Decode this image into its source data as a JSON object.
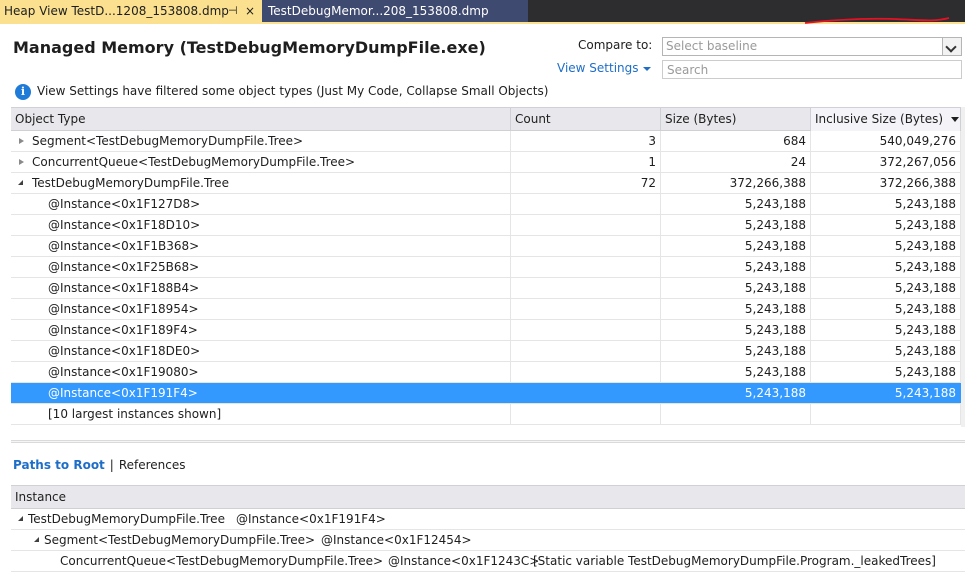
{
  "tabs": {
    "active": "Heap View TestD...1208_153808.dmp",
    "active_pin": "⊣",
    "active_close": "×",
    "inactive": "TestDebugMemor...208_153808.dmp"
  },
  "header": {
    "title": "Managed Memory (TestDebugMemoryDumpFile.exe)",
    "compare_label": "Compare to:",
    "baseline_placeholder": "Select baseline",
    "view_settings": "View Settings",
    "search_placeholder": "Search"
  },
  "info": {
    "icon": "i",
    "text": "View Settings have filtered some object types (Just My Code, Collapse Small Objects)"
  },
  "grid": {
    "columns": [
      "Object Type",
      "Count",
      "Size (Bytes)",
      "Inclusive Size (Bytes)"
    ],
    "sorted_column": "Inclusive Size (Bytes)",
    "rows": [
      {
        "name": "Segment<TestDebugMemoryDumpFile.Tree>",
        "count": "3",
        "size": "684",
        "inclusive": "540,049,276",
        "level": 0,
        "expander": "collapsed",
        "selected": false
      },
      {
        "name": "ConcurrentQueue<TestDebugMemoryDumpFile.Tree>",
        "count": "1",
        "size": "24",
        "inclusive": "372,267,056",
        "level": 0,
        "expander": "collapsed",
        "selected": false
      },
      {
        "name": "TestDebugMemoryDumpFile.Tree",
        "count": "72",
        "size": "372,266,388",
        "inclusive": "372,266,388",
        "level": 0,
        "expander": "expanded",
        "selected": false
      },
      {
        "name": "@Instance<0x1F127D8>",
        "count": "",
        "size": "5,243,188",
        "inclusive": "5,243,188",
        "level": 1,
        "expander": "none",
        "selected": false
      },
      {
        "name": "@Instance<0x1F18D10>",
        "count": "",
        "size": "5,243,188",
        "inclusive": "5,243,188",
        "level": 1,
        "expander": "none",
        "selected": false
      },
      {
        "name": "@Instance<0x1F1B368>",
        "count": "",
        "size": "5,243,188",
        "inclusive": "5,243,188",
        "level": 1,
        "expander": "none",
        "selected": false
      },
      {
        "name": "@Instance<0x1F25B68>",
        "count": "",
        "size": "5,243,188",
        "inclusive": "5,243,188",
        "level": 1,
        "expander": "none",
        "selected": false
      },
      {
        "name": "@Instance<0x1F188B4>",
        "count": "",
        "size": "5,243,188",
        "inclusive": "5,243,188",
        "level": 1,
        "expander": "none",
        "selected": false
      },
      {
        "name": "@Instance<0x1F18954>",
        "count": "",
        "size": "5,243,188",
        "inclusive": "5,243,188",
        "level": 1,
        "expander": "none",
        "selected": false
      },
      {
        "name": "@Instance<0x1F189F4>",
        "count": "",
        "size": "5,243,188",
        "inclusive": "5,243,188",
        "level": 1,
        "expander": "none",
        "selected": false
      },
      {
        "name": "@Instance<0x1F18DE0>",
        "count": "",
        "size": "5,243,188",
        "inclusive": "5,243,188",
        "level": 1,
        "expander": "none",
        "selected": false
      },
      {
        "name": "@Instance<0x1F19080>",
        "count": "",
        "size": "5,243,188",
        "inclusive": "5,243,188",
        "level": 1,
        "expander": "none",
        "selected": false
      },
      {
        "name": "@Instance<0x1F191F4>",
        "count": "",
        "size": "5,243,188",
        "inclusive": "5,243,188",
        "level": 1,
        "expander": "none",
        "selected": true
      },
      {
        "name": "[10 largest instances shown]",
        "count": "",
        "size": "",
        "inclusive": "",
        "level": 1,
        "expander": "none",
        "selected": false
      }
    ]
  },
  "lower": {
    "tab_paths": "Paths to Root",
    "separator": "|",
    "tab_references": "References",
    "column": "Instance",
    "paths": [
      {
        "type": "TestDebugMemoryDumpFile.Tree",
        "instance": "@Instance<0x1F191F4>",
        "extra": "",
        "level": 0,
        "expander": "expanded"
      },
      {
        "type": "Segment<TestDebugMemoryDumpFile.Tree>",
        "instance": "@Instance<0x1F12454>",
        "extra": "",
        "level": 1,
        "expander": "expanded"
      },
      {
        "type": "ConcurrentQueue<TestDebugMemoryDumpFile.Tree>",
        "instance": "@Instance<0x1F1243C>",
        "extra": "[Static variable TestDebugMemoryDumpFile.Program._leakedTrees]",
        "level": 2,
        "expander": "none"
      }
    ]
  },
  "colors": {
    "tab_active": "#fbe18f",
    "tab_inactive": "#3f4a70",
    "selection": "#3399ff",
    "link": "#1e6ec8",
    "annotation": "#e81123"
  }
}
